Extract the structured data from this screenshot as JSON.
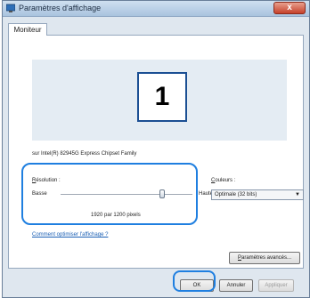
{
  "window": {
    "title": "Paramètres d'affichage",
    "close_label": "x"
  },
  "tabs": [
    {
      "label": "Moniteur"
    }
  ],
  "monitor": {
    "number": "1",
    "adapter": "sur Intel(R) 82945G Express Chipset Family"
  },
  "resolution": {
    "label_mnemonic": "R",
    "label_rest": "ésolution :",
    "low": "Basse",
    "high": "Haute",
    "value": "1920 par 1200 pixels",
    "level": 0.77
  },
  "colors": {
    "label_mnemonic": "C",
    "label_rest": "ouleurs :",
    "selected": "Optimale (32 bits)"
  },
  "help_link": "Comment optimiser l'affichage ?",
  "advanced_button": {
    "mnemonic": "P",
    "rest": "aramètres avancés..."
  },
  "buttons": {
    "ok": "OK",
    "cancel": "Annuler",
    "apply": "Appliquer"
  },
  "accent_color": "#1f7fe0"
}
